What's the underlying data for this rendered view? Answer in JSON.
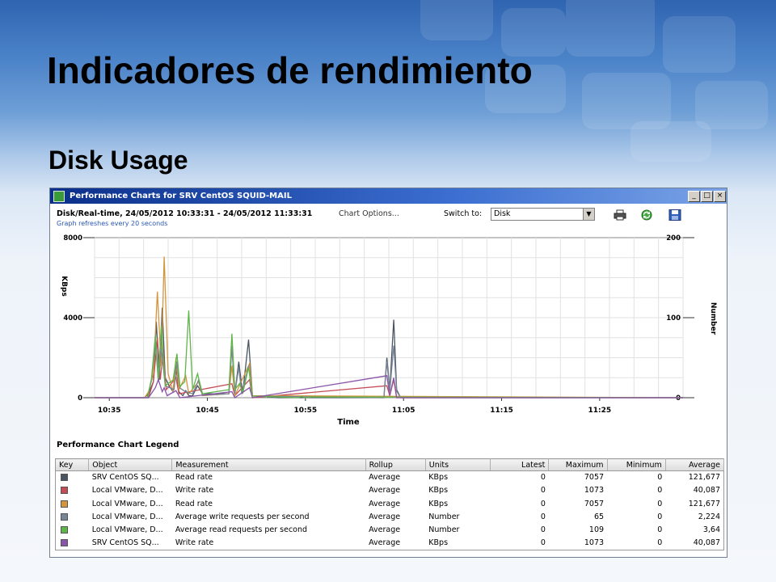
{
  "slide": {
    "title": "Indicadores de rendimiento",
    "subtitle": "Disk Usage"
  },
  "window": {
    "title": "Performance Charts for SRV CentOS SQUID-MAIL",
    "buttons": {
      "minimize": "_",
      "maximize": "□",
      "close": "×"
    }
  },
  "toolbar": {
    "range": "Disk/Real-time, 24/05/2012 10:33:31 - 24/05/2012 11:33:31",
    "chart_options": "Chart Options...",
    "refresh_note": "Graph refreshes every 20 seconds",
    "switch_to_label": "Switch to:",
    "switch_to_value": "Disk",
    "icons": [
      "print-icon",
      "refresh-icon",
      "save-icon"
    ]
  },
  "chart_data": {
    "type": "line",
    "xlabel": "Time",
    "ylabel_left": "KBps",
    "ylabel_right": "Number",
    "x_ticks": [
      "10:35",
      "10:45",
      "10:55",
      "11:05",
      "11:15",
      "11:25"
    ],
    "y_left_ticks": [
      "8000",
      "4000",
      "0"
    ],
    "y_right_ticks": [
      "200",
      "100",
      "0"
    ],
    "ylim_left": [
      0,
      8000
    ],
    "ylim_right": [
      0,
      200
    ],
    "grid": true,
    "series": [
      {
        "axis": "left",
        "color": "#4a5563",
        "points": [
          [
            0,
            0
          ],
          [
            5.1,
            0
          ],
          [
            5.5,
            200
          ],
          [
            6.0,
            800
          ],
          [
            6.3,
            3800
          ],
          [
            6.6,
            900
          ],
          [
            6.9,
            4500
          ],
          [
            7.2,
            1000
          ],
          [
            7.6,
            600
          ],
          [
            8.0,
            300
          ],
          [
            8.3,
            1600
          ],
          [
            8.6,
            300
          ],
          [
            9.0,
            100
          ],
          [
            9.3,
            350
          ],
          [
            9.6,
            100
          ],
          [
            10.0,
            100
          ],
          [
            10.5,
            600
          ],
          [
            11.0,
            200
          ],
          [
            13.7,
            200
          ],
          [
            14.0,
            2600
          ],
          [
            14.3,
            200
          ],
          [
            14.7,
            1800
          ],
          [
            15.1,
            200
          ],
          [
            15.7,
            2900
          ],
          [
            16.1,
            100
          ],
          [
            18.7,
            0
          ],
          [
            29.5,
            0
          ],
          [
            29.8,
            2000
          ],
          [
            30.1,
            400
          ],
          [
            30.5,
            3900
          ],
          [
            30.8,
            400
          ],
          [
            31.2,
            0
          ],
          [
            60,
            0
          ]
        ]
      },
      {
        "axis": "left",
        "color": "#c44c55",
        "points": [
          [
            0,
            0
          ],
          [
            5.5,
            0
          ],
          [
            6.0,
            800
          ],
          [
            6.4,
            3000
          ],
          [
            6.7,
            900
          ],
          [
            7.0,
            2400
          ],
          [
            7.3,
            400
          ],
          [
            8.3,
            1000
          ],
          [
            8.6,
            200
          ],
          [
            14.0,
            700
          ],
          [
            14.3,
            100
          ],
          [
            15.8,
            900
          ],
          [
            16.1,
            0
          ],
          [
            29.8,
            600
          ],
          [
            30.1,
            100
          ],
          [
            30.5,
            900
          ],
          [
            30.8,
            0
          ],
          [
            60,
            0
          ]
        ]
      },
      {
        "axis": "left",
        "color": "#d4953f",
        "points": [
          [
            0,
            0
          ],
          [
            5.1,
            0
          ],
          [
            5.5,
            300
          ],
          [
            6.0,
            1200
          ],
          [
            6.4,
            5300
          ],
          [
            6.8,
            1500
          ],
          [
            7.1,
            7050
          ],
          [
            7.5,
            1200
          ],
          [
            8.0,
            300
          ],
          [
            8.3,
            2000
          ],
          [
            8.6,
            400
          ],
          [
            9.3,
            1100
          ],
          [
            9.6,
            200
          ],
          [
            10.6,
            800
          ],
          [
            11.0,
            100
          ],
          [
            13.7,
            200
          ],
          [
            14.0,
            1600
          ],
          [
            14.3,
            100
          ],
          [
            15.8,
            1700
          ],
          [
            16.1,
            100
          ],
          [
            60,
            0
          ]
        ]
      },
      {
        "axis": "right",
        "color": "#7a8696",
        "points": [
          [
            0,
            0
          ],
          [
            5.4,
            0
          ],
          [
            5.8,
            22
          ],
          [
            6.2,
            70
          ],
          [
            6.5,
            20
          ],
          [
            6.8,
            62
          ],
          [
            7.2,
            15
          ],
          [
            8.1,
            10
          ],
          [
            8.4,
            45
          ],
          [
            8.7,
            12
          ],
          [
            9.2,
            8
          ],
          [
            10.0,
            5
          ],
          [
            10.6,
            22
          ],
          [
            11.0,
            3
          ],
          [
            13.7,
            5
          ],
          [
            14.0,
            65
          ],
          [
            14.3,
            5
          ],
          [
            14.7,
            38
          ],
          [
            15.0,
            5
          ],
          [
            15.7,
            40
          ],
          [
            16.1,
            2
          ],
          [
            29.5,
            0
          ],
          [
            29.8,
            45
          ],
          [
            30.1,
            8
          ],
          [
            30.5,
            65
          ],
          [
            30.8,
            8
          ],
          [
            31.2,
            0
          ],
          [
            60,
            0
          ]
        ]
      },
      {
        "axis": "right",
        "color": "#5fb54a",
        "points": [
          [
            0,
            0
          ],
          [
            5.4,
            0
          ],
          [
            5.8,
            24
          ],
          [
            6.2,
            78
          ],
          [
            6.5,
            22
          ],
          [
            6.8,
            90
          ],
          [
            7.2,
            15
          ],
          [
            8.0,
            22
          ],
          [
            8.4,
            55
          ],
          [
            8.7,
            14
          ],
          [
            9.2,
            20
          ],
          [
            9.6,
            109
          ],
          [
            10.0,
            10
          ],
          [
            10.5,
            30
          ],
          [
            11.0,
            5
          ],
          [
            13.7,
            10
          ],
          [
            14.0,
            80
          ],
          [
            14.3,
            10
          ],
          [
            14.8,
            18
          ],
          [
            15.1,
            5
          ],
          [
            15.7,
            38
          ],
          [
            16.1,
            2
          ],
          [
            20.8,
            0
          ],
          [
            21.1,
            2
          ],
          [
            21.4,
            0
          ],
          [
            22.3,
            1
          ],
          [
            60,
            0
          ]
        ]
      },
      {
        "axis": "left",
        "color": "#8a54a8",
        "points": [
          [
            0,
            0
          ],
          [
            5.5,
            0
          ],
          [
            6.2,
            500
          ],
          [
            6.5,
            900
          ],
          [
            6.9,
            300
          ],
          [
            7.1,
            500
          ],
          [
            7.4,
            100
          ],
          [
            8.3,
            350
          ],
          [
            8.7,
            0
          ],
          [
            14.0,
            300
          ],
          [
            14.3,
            0
          ],
          [
            15.8,
            500
          ],
          [
            16.1,
            0
          ],
          [
            29.8,
            1100
          ],
          [
            30.1,
            100
          ],
          [
            30.5,
            1000
          ],
          [
            30.8,
            0
          ],
          [
            60,
            0
          ]
        ]
      }
    ]
  },
  "legend": {
    "title": "Performance Chart Legend",
    "headers": [
      "Key",
      "Object",
      "Measurement",
      "Rollup",
      "Units",
      "Latest",
      "Maximum",
      "Minimum",
      "Average"
    ],
    "rows": [
      {
        "color": "#4a5563",
        "object": "SRV CentOS SQ...",
        "measurement": "Read rate",
        "rollup": "Average",
        "units": "KBps",
        "latest": "0",
        "maximum": "7057",
        "minimum": "0",
        "average": "121,677"
      },
      {
        "color": "#c44c55",
        "object": "Local VMware, D...",
        "measurement": "Write rate",
        "rollup": "Average",
        "units": "KBps",
        "latest": "0",
        "maximum": "1073",
        "minimum": "0",
        "average": "40,087"
      },
      {
        "color": "#d4953f",
        "object": "Local VMware, D...",
        "measurement": "Read rate",
        "rollup": "Average",
        "units": "KBps",
        "latest": "0",
        "maximum": "7057",
        "minimum": "0",
        "average": "121,677"
      },
      {
        "color": "#7a8696",
        "object": "Local VMware, D...",
        "measurement": "Average write requests per second",
        "rollup": "Average",
        "units": "Number",
        "latest": "0",
        "maximum": "65",
        "minimum": "0",
        "average": "2,224"
      },
      {
        "color": "#5fb54a",
        "object": "Local VMware, D...",
        "measurement": "Average read requests per second",
        "rollup": "Average",
        "units": "Number",
        "latest": "0",
        "maximum": "109",
        "minimum": "0",
        "average": "3,64"
      },
      {
        "color": "#8a54a8",
        "object": "SRV CentOS SQ...",
        "measurement": "Write rate",
        "rollup": "Average",
        "units": "KBps",
        "latest": "0",
        "maximum": "1073",
        "minimum": "0",
        "average": "40,087"
      }
    ]
  }
}
